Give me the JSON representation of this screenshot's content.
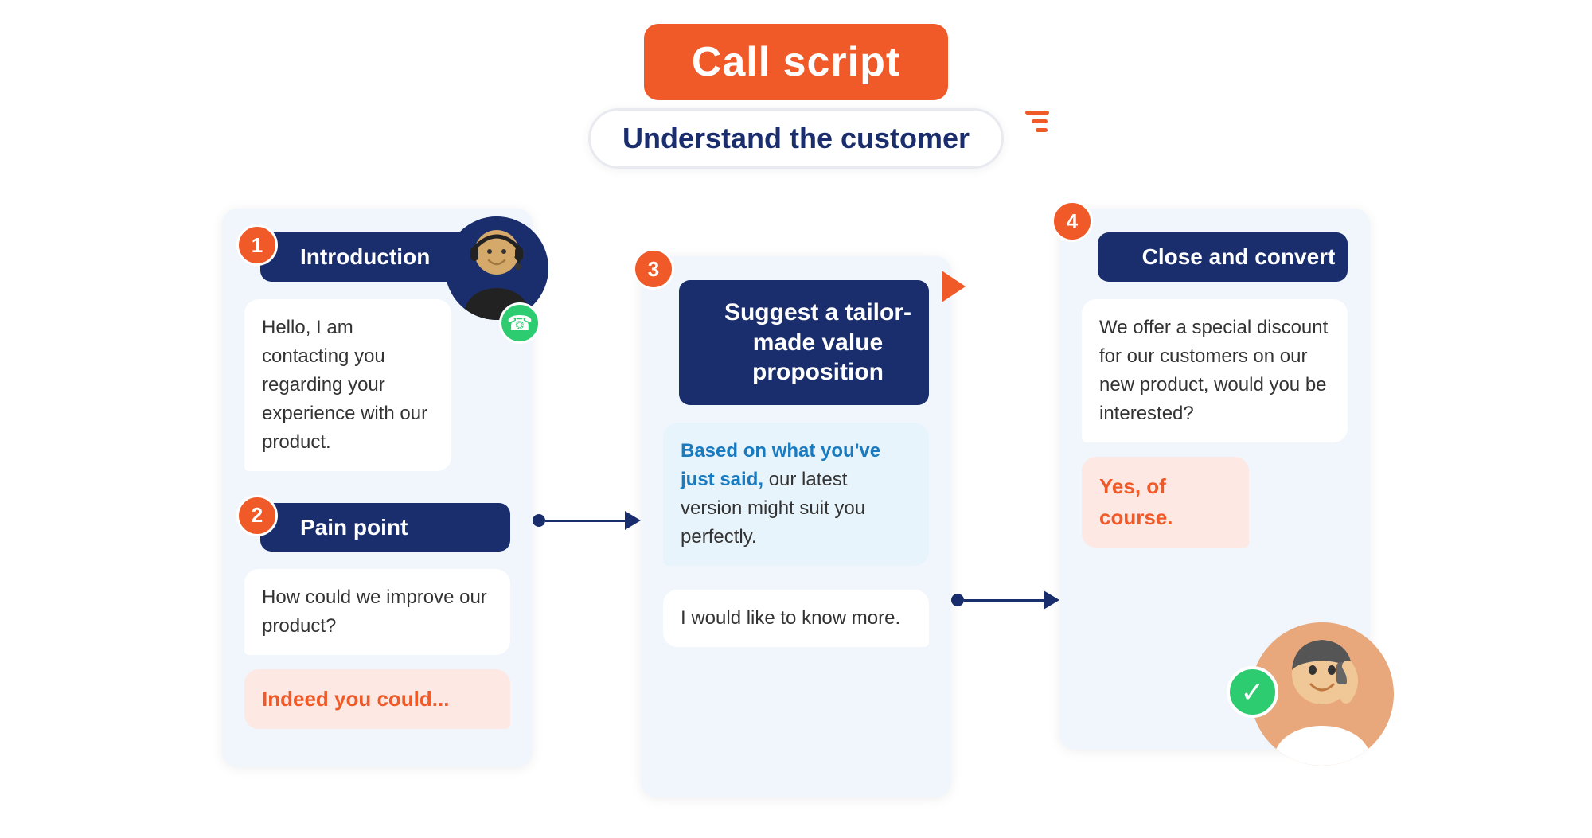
{
  "title": "Call script",
  "subtitle": "Understand the customer",
  "steps": [
    {
      "number": "1",
      "title": "Introduction",
      "bubble1": "Hello, I am contacting you regarding your experience with our product.",
      "has_avatar": true
    },
    {
      "number": "2",
      "title": "Pain point",
      "bubble1": "How could we improve our product?",
      "bubble2": "Indeed you could..."
    },
    {
      "number": "3",
      "title": "Suggest a tailor-made value proposition",
      "bubble1_highlight": "Based on what you've just said,",
      "bubble1_rest": " our latest version might suit you perfectly.",
      "bubble2": "I would like to know more."
    },
    {
      "number": "4",
      "title": "Close and convert",
      "bubble1": "We offer a special discount for our customers on our new product, would you be interested?",
      "bubble2": "Yes, of course.",
      "has_avatar": true
    }
  ],
  "connector_between_12_3": true,
  "connector_between_3_4": true
}
